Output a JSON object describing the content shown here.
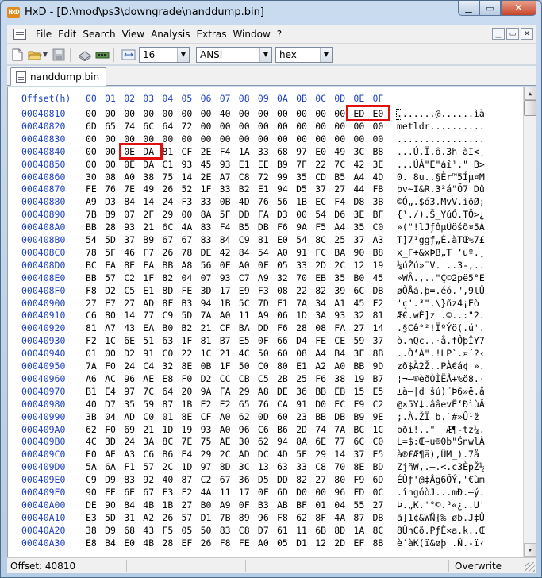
{
  "window": {
    "app_icon": "HxD",
    "title": "HxD - [D:\\mod\\ps3\\downgrade\\nanddump.bin]",
    "min_label": "▁",
    "max_label": "▭",
    "close_label": "✕"
  },
  "menu": {
    "items": [
      "File",
      "Edit",
      "Search",
      "View",
      "Analysis",
      "Extras",
      "Window",
      "?"
    ],
    "mdi": [
      "▁",
      "▭",
      "✕"
    ]
  },
  "toolbar": {
    "bytes_per_row": "16",
    "charset": "ANSI",
    "offset_base": "hex"
  },
  "tab": {
    "label": "nanddump.bin"
  },
  "editor": {
    "offset_header": "Offset(h)",
    "column_headers": [
      "00",
      "01",
      "02",
      "03",
      "04",
      "05",
      "06",
      "07",
      "08",
      "09",
      "0A",
      "0B",
      "0C",
      "0D",
      "0E",
      "0F"
    ],
    "rows": [
      {
        "offset": "00040810",
        "bytes": [
          "00",
          "00",
          "00",
          "00",
          "00",
          "00",
          "00",
          "40",
          "00",
          "00",
          "00",
          "00",
          "00",
          "00",
          "ED",
          "E0"
        ],
        "ascii": ".......@......ìà"
      },
      {
        "offset": "00040820",
        "bytes": [
          "6D",
          "65",
          "74",
          "6C",
          "64",
          "72",
          "00",
          "00",
          "00",
          "00",
          "00",
          "00",
          "00",
          "00",
          "00",
          "00"
        ],
        "ascii": "metldr.........."
      },
      {
        "offset": "00040830",
        "bytes": [
          "00",
          "00",
          "00",
          "00",
          "00",
          "00",
          "00",
          "00",
          "00",
          "00",
          "00",
          "00",
          "00",
          "00",
          "00",
          "00"
        ],
        "ascii": "................"
      },
      {
        "offset": "00040840",
        "bytes": [
          "00",
          "00",
          "0E",
          "DA",
          "81",
          "CF",
          "2E",
          "F4",
          "1A",
          "33",
          "68",
          "97",
          "E0",
          "49",
          "3C",
          "B8"
        ],
        "ascii": "...Ú.Ï.ô.3h—àI<¸"
      },
      {
        "offset": "00040850",
        "bytes": [
          "00",
          "00",
          "0E",
          "DA",
          "C1",
          "93",
          "45",
          "93",
          "E1",
          "EE",
          "B9",
          "7F",
          "22",
          "7C",
          "42",
          "3E"
        ],
        "ascii": "...ÚÁ\"E\"áî¹.\"|B>"
      },
      {
        "offset": "00040860",
        "bytes": [
          "30",
          "08",
          "A0",
          "38",
          "75",
          "14",
          "2E",
          "A7",
          "C8",
          "72",
          "99",
          "35",
          "CD",
          "B5",
          "A4",
          "4D"
        ],
        "ascii": "0. 8u..§Èr™5Íµ¤M"
      },
      {
        "offset": "00040870",
        "bytes": [
          "FE",
          "76",
          "7E",
          "49",
          "26",
          "52",
          "1F",
          "33",
          "B2",
          "E1",
          "94",
          "D5",
          "37",
          "27",
          "44",
          "FB"
        ],
        "ascii": "þv~I&R.3²á\"Õ7'Dû"
      },
      {
        "offset": "00040880",
        "bytes": [
          "A9",
          "D3",
          "84",
          "14",
          "24",
          "F3",
          "33",
          "0B",
          "4D",
          "76",
          "56",
          "1B",
          "EC",
          "F4",
          "D8",
          "3B"
        ],
        "ascii": "©Ó„.$ó3.MvV.ìôØ;"
      },
      {
        "offset": "00040890",
        "bytes": [
          "7B",
          "B9",
          "07",
          "2F",
          "29",
          "00",
          "8A",
          "5F",
          "DD",
          "FA",
          "D3",
          "00",
          "54",
          "D6",
          "3E",
          "BF"
        ],
        "ascii": "{¹./).Š_ÝúÓ.TÖ>¿"
      },
      {
        "offset": "000408A0",
        "bytes": [
          "BB",
          "28",
          "93",
          "21",
          "6C",
          "4A",
          "83",
          "F4",
          "B5",
          "DB",
          "F6",
          "9A",
          "F5",
          "A4",
          "35",
          "C0"
        ],
        "ascii": "»(\"!lJƒôµÛöšõ¤5À"
      },
      {
        "offset": "000408B0",
        "bytes": [
          "54",
          "5D",
          "37",
          "B9",
          "67",
          "67",
          "83",
          "84",
          "C9",
          "81",
          "E0",
          "54",
          "8C",
          "25",
          "37",
          "A3"
        ],
        "ascii": "T]7¹ggƒ„É.àTŒ%7£"
      },
      {
        "offset": "000408C0",
        "bytes": [
          "78",
          "5F",
          "46",
          "F7",
          "26",
          "78",
          "DE",
          "42",
          "84",
          "54",
          "A0",
          "91",
          "FC",
          "BA",
          "90",
          "B8"
        ],
        "ascii": "x_F÷&xÞB„T ‘üº.¸"
      },
      {
        "offset": "000408D0",
        "bytes": [
          "BC",
          "FA",
          "8E",
          "FA",
          "BB",
          "A8",
          "56",
          "0F",
          "A0",
          "0F",
          "05",
          "33",
          "2D",
          "2C",
          "12",
          "19"
        ],
        "ascii": "¼úŽú»¨V. ..3-,.."
      },
      {
        "offset": "000408E0",
        "bytes": [
          "BB",
          "57",
          "C2",
          "1F",
          "82",
          "04",
          "07",
          "93",
          "C7",
          "A9",
          "32",
          "70",
          "EB",
          "35",
          "B0",
          "45"
        ],
        "ascii": "»WÂ.‚..\"Ç©2pë5°E"
      },
      {
        "offset": "000408F0",
        "bytes": [
          "F8",
          "D2",
          "C5",
          "E1",
          "8D",
          "FE",
          "3D",
          "17",
          "E9",
          "F3",
          "08",
          "22",
          "82",
          "39",
          "6C",
          "DB"
        ],
        "ascii": "øÒÅá.þ=.éó.\"‚9lÛ"
      },
      {
        "offset": "00040900",
        "bytes": [
          "27",
          "E7",
          "27",
          "AD",
          "8F",
          "B3",
          "94",
          "1B",
          "5C",
          "7D",
          "F1",
          "7A",
          "34",
          "A1",
          "45",
          "F2"
        ],
        "ascii": "'ç'­.³\".\\}ñz4¡Eò"
      },
      {
        "offset": "00040910",
        "bytes": [
          "C6",
          "80",
          "14",
          "77",
          "C9",
          "5D",
          "7A",
          "A0",
          "11",
          "A9",
          "06",
          "1D",
          "3A",
          "93",
          "32",
          "81"
        ],
        "ascii": "Æ€.wÉ]z .©..:\"2."
      },
      {
        "offset": "00040920",
        "bytes": [
          "81",
          "A7",
          "43",
          "EA",
          "B0",
          "B2",
          "21",
          "CF",
          "BA",
          "DD",
          "F6",
          "28",
          "08",
          "FA",
          "27",
          "14"
        ],
        "ascii": ".§Cê°²!ÏºÝö(.ú'."
      },
      {
        "offset": "00040930",
        "bytes": [
          "F2",
          "1C",
          "6E",
          "51",
          "63",
          "1F",
          "81",
          "B7",
          "E5",
          "0F",
          "66",
          "D4",
          "FE",
          "CE",
          "59",
          "37"
        ],
        "ascii": "ò.nQc..·å.fÔþÎY7"
      },
      {
        "offset": "00040940",
        "bytes": [
          "01",
          "00",
          "D2",
          "91",
          "C0",
          "22",
          "1C",
          "21",
          "4C",
          "50",
          "60",
          "08",
          "A4",
          "B4",
          "3F",
          "8B"
        ],
        "ascii": "..Ò‘À\".!LP`.¤´?‹"
      },
      {
        "offset": "00040950",
        "bytes": [
          "7A",
          "F0",
          "24",
          "C4",
          "32",
          "8E",
          "0B",
          "1F",
          "50",
          "C0",
          "80",
          "E1",
          "A2",
          "A0",
          "BB",
          "9D"
        ],
        "ascii": "zð$Ä2Ž..PÀ€á¢ »."
      },
      {
        "offset": "00040960",
        "bytes": [
          "A6",
          "AC",
          "96",
          "AE",
          "E8",
          "F0",
          "D2",
          "CC",
          "CB",
          "C5",
          "2B",
          "25",
          "F6",
          "38",
          "19",
          "B7"
        ],
        "ascii": "¦¬–®èðÒÌËÅ+%ö8.·"
      },
      {
        "offset": "00040970",
        "bytes": [
          "B1",
          "E4",
          "97",
          "7C",
          "64",
          "20",
          "9A",
          "FA",
          "29",
          "A8",
          "DE",
          "36",
          "BB",
          "EB",
          "15",
          "E5"
        ],
        "ascii": "±ä—|d šú)¨Þ6»ë.å"
      },
      {
        "offset": "00040980",
        "bytes": [
          "40",
          "D7",
          "35",
          "59",
          "87",
          "1B",
          "E2",
          "E2",
          "65",
          "76",
          "CA",
          "91",
          "D0",
          "EC",
          "F9",
          "C2"
        ],
        "ascii": "@×5Y‡.ââevÊ‘ÐìùÂ"
      },
      {
        "offset": "00040990",
        "bytes": [
          "3B",
          "04",
          "AD",
          "C0",
          "01",
          "8E",
          "CF",
          "A0",
          "62",
          "0D",
          "60",
          "23",
          "BB",
          "DB",
          "B9",
          "9E"
        ],
        "ascii": ";.­À.ŽÏ b.`#»Û¹ž"
      },
      {
        "offset": "000409A0",
        "bytes": [
          "62",
          "F0",
          "69",
          "21",
          "1D",
          "19",
          "93",
          "A0",
          "96",
          "C6",
          "B6",
          "2D",
          "74",
          "7A",
          "BC",
          "1C"
        ],
        "ascii": "bði!..\" –Æ¶-tz¼."
      },
      {
        "offset": "000409B0",
        "bytes": [
          "4C",
          "3D",
          "24",
          "3A",
          "8C",
          "7E",
          "75",
          "AE",
          "30",
          "62",
          "94",
          "8A",
          "6E",
          "77",
          "6C",
          "C0"
        ],
        "ascii": "L=$:Œ~u®0b\"ŠnwlÀ"
      },
      {
        "offset": "000409C0",
        "bytes": [
          "E0",
          "AE",
          "A3",
          "C6",
          "B6",
          "E4",
          "29",
          "2C",
          "AD",
          "DC",
          "4D",
          "5F",
          "29",
          "14",
          "37",
          "E5"
        ],
        "ascii": "à®£Æ¶ä),­ÜM_).7å"
      },
      {
        "offset": "000409D0",
        "bytes": [
          "5A",
          "6A",
          "F1",
          "57",
          "2C",
          "1D",
          "97",
          "8D",
          "3C",
          "13",
          "63",
          "33",
          "C8",
          "70",
          "8E",
          "BD"
        ],
        "ascii": "ZjñW,.—.<.c3ÈpŽ½"
      },
      {
        "offset": "000409E0",
        "bytes": [
          "C9",
          "D9",
          "83",
          "92",
          "40",
          "87",
          "C2",
          "67",
          "36",
          "D5",
          "DD",
          "82",
          "27",
          "80",
          "F9",
          "6D"
        ],
        "ascii": "ÉÙƒ'@‡Âg6ÕÝ‚'€ùm"
      },
      {
        "offset": "000409F0",
        "bytes": [
          "90",
          "EE",
          "6E",
          "67",
          "F3",
          "F2",
          "4A",
          "11",
          "17",
          "0F",
          "6D",
          "D0",
          "00",
          "96",
          "FD",
          "0C"
        ],
        "ascii": ".îngóòJ...mÐ.–ý."
      },
      {
        "offset": "00040A00",
        "bytes": [
          "DE",
          "90",
          "84",
          "4B",
          "1B",
          "27",
          "B0",
          "A9",
          "0F",
          "B3",
          "AB",
          "BF",
          "01",
          "04",
          "55",
          "27"
        ],
        "ascii": "Þ.„K.'°©.³«¿..U'"
      },
      {
        "offset": "00040A10",
        "bytes": [
          "E3",
          "5D",
          "31",
          "A2",
          "26",
          "57",
          "D1",
          "7B",
          "89",
          "96",
          "F8",
          "62",
          "8F",
          "4A",
          "87",
          "DB"
        ],
        "ascii": "ã]1¢&WÑ{‰–øb.J‡Û"
      },
      {
        "offset": "00040A20",
        "bytes": [
          "38",
          "D9",
          "68",
          "43",
          "F5",
          "05",
          "50",
          "83",
          "C8",
          "D7",
          "61",
          "11",
          "6B",
          "8D",
          "1A",
          "8C"
        ],
        "ascii": "8ÙhCõ.PƒÈ×a.k..Œ"
      },
      {
        "offset": "00040A30",
        "bytes": [
          "E8",
          "B4",
          "E0",
          "4B",
          "28",
          "EF",
          "26",
          "F8",
          "FE",
          "A0",
          "05",
          "D1",
          "12",
          "2D",
          "EF",
          "8B"
        ],
        "ascii": "è´àK(ï&øþ .Ñ.-ï‹"
      }
    ]
  },
  "status": {
    "offset": "Offset: 40810",
    "mode": "Overwrite"
  },
  "colors": {
    "highlight": "#e01010",
    "offset_blue": "#1d41c5"
  }
}
